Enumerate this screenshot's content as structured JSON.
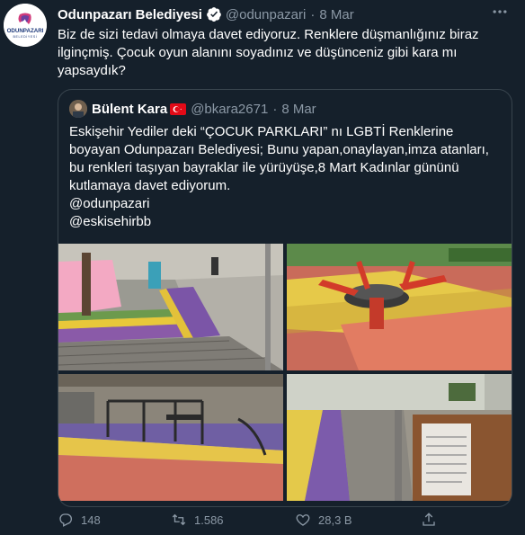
{
  "tweet": {
    "author_name": "Odunpazarı Belediyesi",
    "author_handle": "@odunpazari",
    "separator": "·",
    "date": "8 Mar",
    "text": "Biz de sizi tedavi olmaya davet ediyoruz. Renklere düşmanlığınız biraz ilginçmiş. Çocuk oyun alanını soyadınız ve düşünceniz gibi kara mı yapsaydık?",
    "avatar_logo_text": "ODUNPAZARI",
    "avatar_logo_subtext": "BELEDİYESİ"
  },
  "quoted": {
    "author_name": "Bülent Kara",
    "author_handle": "@bkara2671",
    "separator": "·",
    "date": "8 Mar",
    "text": "Eskişehir Yediler deki “ÇOCUK PARKLARI” nı LGBTİ Renklerine boyayan Odunpazarı Belediyesi; Bunu yapan,onaylayan,imza atanları, bu renkleri taşıyan bayraklar ile yürüyüşe,8 Mart Kadınlar gününü kutlamaya davet ediyorum.",
    "mention1": "@odunpazari",
    "mention2": "@eskisehirbb"
  },
  "actions": {
    "replies": "148",
    "retweets": "1.586",
    "likes": "28,3 B"
  },
  "icons": {
    "verified": "verified-badge-icon",
    "more": "more-options-icon",
    "reply": "reply-icon",
    "retweet": "retweet-icon",
    "like": "heart-icon",
    "share": "share-icon",
    "flag": "turkey-flag-icon"
  },
  "colors": {
    "background": "#15202b",
    "text": "#ffffff",
    "secondary": "#8b98a5",
    "border": "#38444d",
    "verified": "#ffffff"
  }
}
